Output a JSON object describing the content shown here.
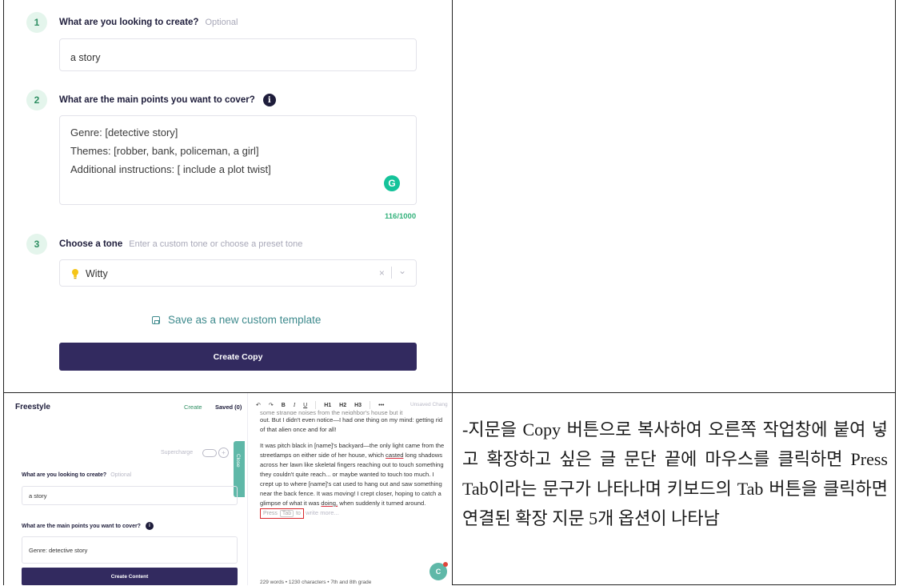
{
  "form": {
    "step1": {
      "num": "1",
      "label": "What are you looking to create?",
      "optional": "Optional",
      "value": "a story"
    },
    "step2": {
      "num": "2",
      "label": "What are the main points you want to cover?",
      "info_icon": "i",
      "lines": [
        "Genre: [detective story]",
        "Themes: [robber, bank, policeman, a girl]",
        "",
        "Additional instructions: [ include a plot twist]"
      ],
      "grammarly_icon": "G",
      "counter": "116/1000"
    },
    "step3": {
      "num": "3",
      "label": "Choose a tone",
      "hint": "Enter a custom tone or choose a preset tone",
      "value": "Witty",
      "bulb_icon": "lightbulb-icon",
      "clear": "×",
      "chevron": "⌄"
    },
    "save_template": "Save as a new custom template",
    "create_button": "Create Copy"
  },
  "freestyle": {
    "title": "Freestyle",
    "tab_create": "Create",
    "tab_saved": "Saved (0)",
    "supercharge": "Supercharge",
    "plus": "+",
    "close": "Close",
    "q1_label": "What are you looking to create?",
    "q1_optional": "Optional",
    "q1_value": "a story",
    "q2_label": "What are the main points you want to cover?",
    "q2_info": "i",
    "q2_value": "Genre: detective story",
    "create_button": "Create Content",
    "toolbar": {
      "undo": "↶",
      "redo": "↷",
      "bold": "B",
      "italic": "I",
      "underline": "U",
      "h1": "H1",
      "h2": "H2",
      "h3": "H3",
      "more": "•••",
      "unsaved": "Unsaved Chang"
    },
    "editor": {
      "cut_line": "some strange noises from the neighbor's house but it",
      "p1": "out. But I didn't even notice—I had one thing on my mind: getting rid of that alien once and for all!",
      "p2_a": "It was pitch black in [name]'s backyard—the only light came from the streetlamps on either side of her house, which",
      "p2_casted": "casted",
      "p2_b": "long shadows across her lawn like skeletal fingers reaching out to touch something they couldn't quite reach... or maybe wanted to touch too much. I crept up to where [name]'s cat used to hang out and saw something near the back fence. It was moving! I crept closer, hoping to catch a glimpse of what it was",
      "p2_doing": "doing,",
      "p2_c": "when suddenly it turned around.",
      "press": "Press",
      "tab_key": "Tab",
      "to": "to",
      "write_more": "write more..."
    },
    "status": "229 words  •  1230 characters  •  7th and 8th grade",
    "chat_icon": "C"
  },
  "description": "-지문을 Copy 버튼으로 복사하여 오른쪽 작업창에 붙여 넣고 확장하고 싶은 글 문단 끝에 마우스를 클릭하면 Press Tab이라는 문구가 나타나며 키보드의 Tab 버튼을 클릭하면 연결된 확장 지문 5개 옵션이 나타남",
  "colors": {
    "brand_dark": "#322a5f",
    "accent_green": "#2f8f63",
    "teal": "#3e8a8d",
    "highlight_red": "#d9262b"
  }
}
